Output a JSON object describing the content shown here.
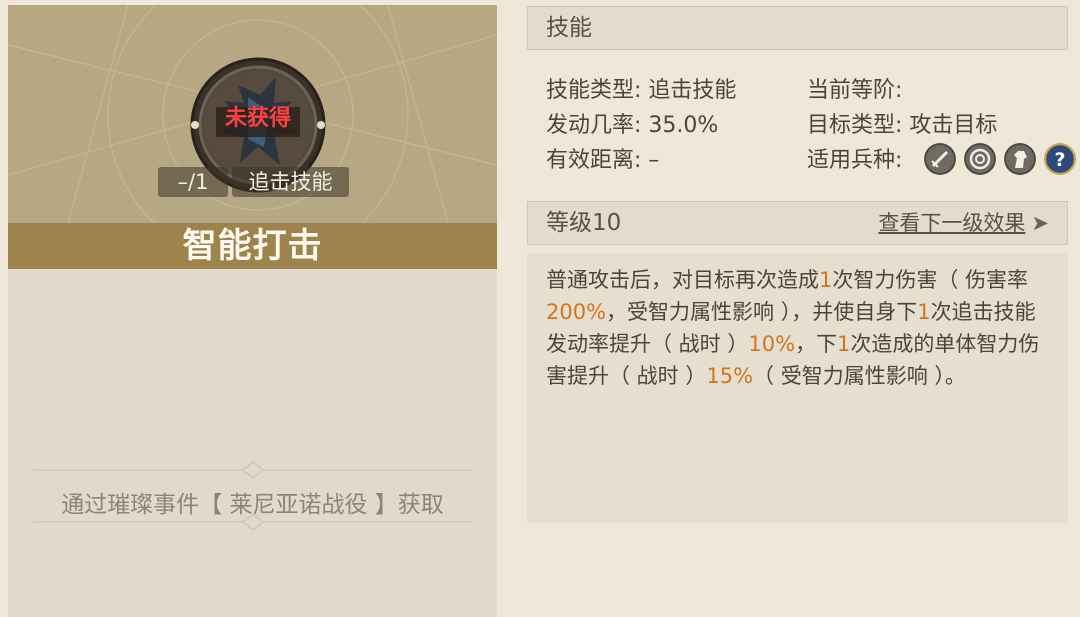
{
  "skill_card": {
    "status": "未获得",
    "level": "–/1",
    "type_tag": "追击技能",
    "name": "智能打击",
    "source": "通过璀璨事件【 莱尼亚诺战役 】获取"
  },
  "skill_section": {
    "header": "技能",
    "attributes": {
      "skill_type_label": "技能类型:",
      "skill_type_value": "追击技能",
      "current_rank_label": "当前等阶:",
      "current_rank_value": "",
      "trigger_rate_label": "发动几率:",
      "trigger_rate_value": "35.0%",
      "target_type_label": "目标类型:",
      "target_type_value": "攻击目标",
      "effective_range_label": "有效距离:",
      "effective_range_value": "–",
      "applicable_units_label": "适用兵种:"
    },
    "unit_icons": [
      "sword-icon",
      "target-icon",
      "horse-icon",
      "question-icon"
    ]
  },
  "level_section": {
    "header": "等级10",
    "next_link": "查看下一级效果",
    "next_arrow": "➤"
  },
  "description": {
    "segments": [
      {
        "t": "普通攻击后，对目标再次造成",
        "hl": false
      },
      {
        "t": "1",
        "hl": true
      },
      {
        "t": "次智力伤害（ 伤害率",
        "hl": false
      },
      {
        "t": "200%",
        "hl": true
      },
      {
        "t": "，受智力属性影响 ），并使自身下",
        "hl": false
      },
      {
        "t": "1",
        "hl": true
      },
      {
        "t": "次追击技能发动率提升（ 战时 ）",
        "hl": false
      },
      {
        "t": "10%",
        "hl": true
      },
      {
        "t": "，下",
        "hl": false
      },
      {
        "t": "1",
        "hl": true
      },
      {
        "t": "次造成的单体智力伤害提升（ 战时 ）",
        "hl": false
      },
      {
        "t": "15%",
        "hl": true
      },
      {
        "t": "（ 受智力属性影响 ）。",
        "hl": false
      }
    ]
  },
  "colors": {
    "highlight": "#d2761e",
    "status_red": "#ff4141",
    "name_band": "#9f834c"
  }
}
